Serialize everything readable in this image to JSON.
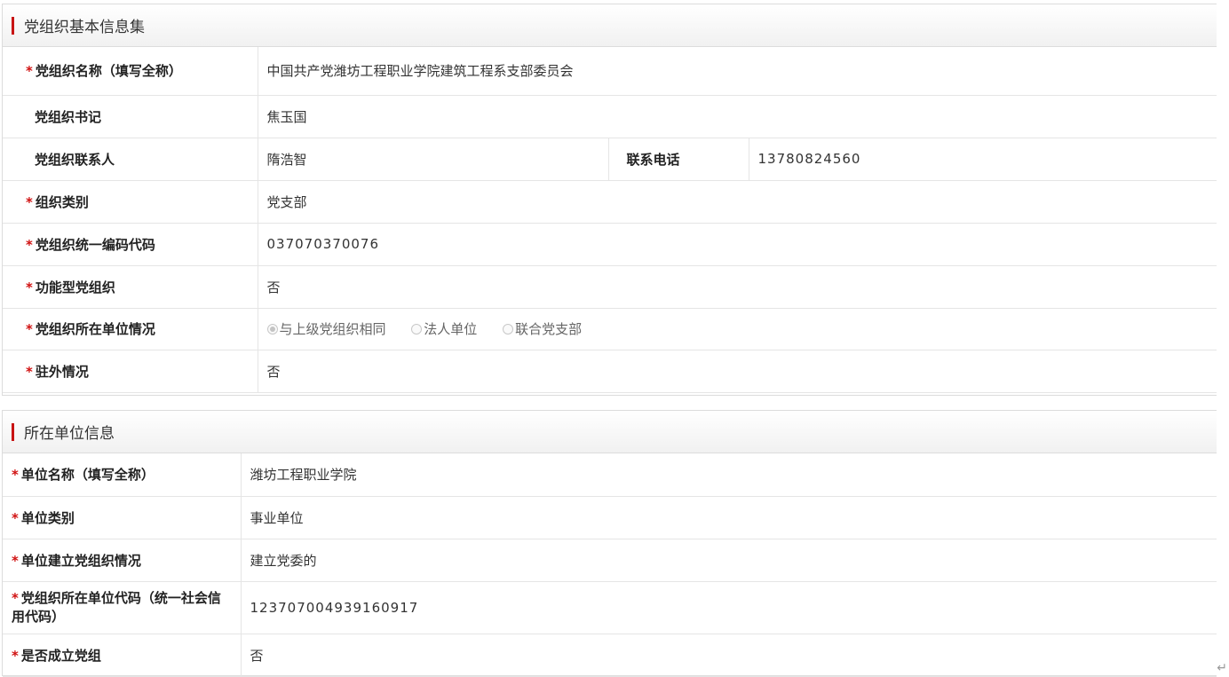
{
  "section1": {
    "title": "党组织基本信息集",
    "rows": [
      {
        "label": "党组织名称（填写全称）",
        "value": "中国共产党潍坊工程职业学院建筑工程系支部委员会"
      },
      {
        "label": "党组织书记",
        "value": "焦玉国"
      },
      {
        "label": "党组织联系人",
        "value": "隋浩智",
        "label2": "联系电话",
        "value2": "13780824560"
      },
      {
        "label": "组织类别",
        "value": "党支部"
      },
      {
        "label": "党组织统一编码代码",
        "value": "037070370076"
      },
      {
        "label": "功能型党组织",
        "value": "否"
      },
      {
        "label": "党组织所在单位情况",
        "options": [
          "与上级党组织相同",
          "法人单位",
          "联合党支部"
        ],
        "selected": "与上级党组织相同"
      },
      {
        "label": "驻外情况",
        "value": "否"
      }
    ]
  },
  "section2": {
    "title": "所在单位信息",
    "rows": [
      {
        "label": "单位名称（填写全称）",
        "value": "潍坊工程职业学院"
      },
      {
        "label": "单位类别",
        "value": "事业单位"
      },
      {
        "label": "单位建立党组织情况",
        "value": "建立党委的"
      },
      {
        "label": "党组织所在单位代码（统一社会信用代码）",
        "value": "123707004939160917"
      },
      {
        "label": "是否成立党组",
        "value": "否"
      }
    ]
  },
  "required_mark": "*",
  "return_glyph": "↵",
  "colors": {
    "accent": "#c81414",
    "required": "#d01010"
  }
}
